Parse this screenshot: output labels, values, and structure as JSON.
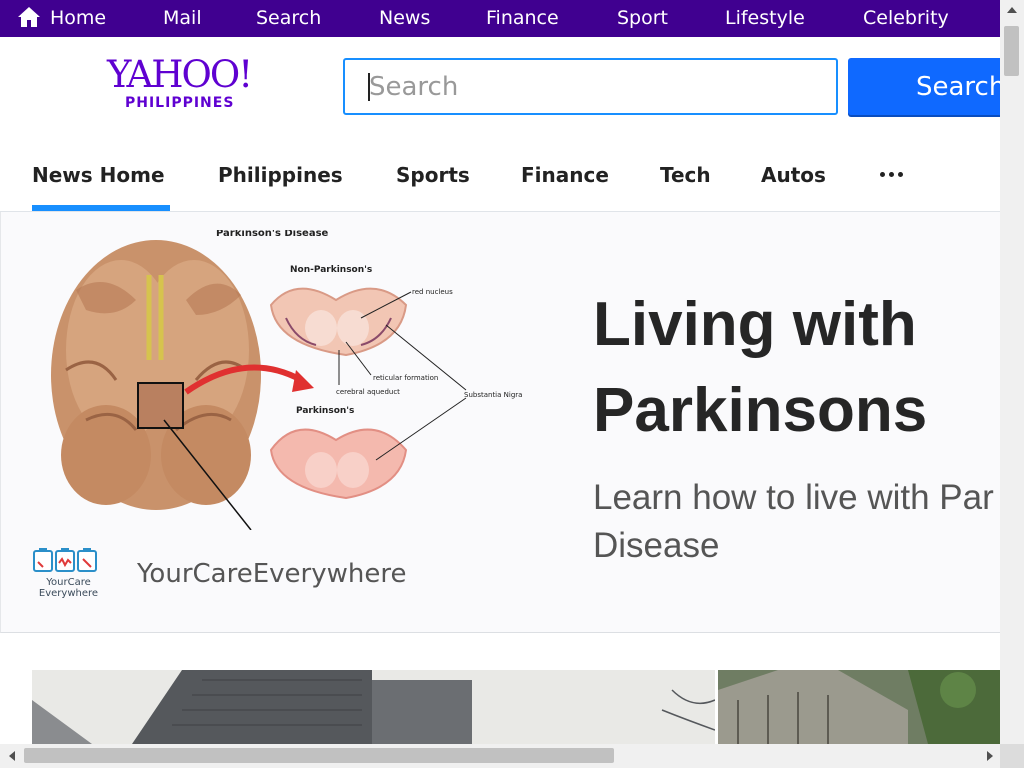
{
  "topbar": {
    "items": [
      "Home",
      "Mail",
      "Search",
      "News",
      "Finance",
      "Sport",
      "Lifestyle",
      "Celebrity"
    ],
    "home_icon": "home-icon",
    "background": "#400090"
  },
  "header": {
    "logo_word": "YAHOO!",
    "logo_region": "PHILIPPINES",
    "search_placeholder": "Search",
    "search_button": "Search",
    "brand_color": "#5f01d1",
    "accent": "#0f69ff"
  },
  "section_nav": {
    "tabs": [
      "News Home",
      "Philippines",
      "Sports",
      "Finance",
      "Tech",
      "Autos"
    ],
    "active_tab": "News Home",
    "more_icon": "more-dots-icon"
  },
  "ad": {
    "headline_line1": "Living with",
    "headline_line2": "Parkinsons",
    "sub_line1": "Learn how to live with Par",
    "sub_line2": "Disease",
    "brand": "YourCareEverywhere",
    "logo_caption_line1": "YourCare",
    "logo_caption_line2": "Everywhere",
    "illustration": {
      "title": "Parkinson's Disease",
      "label_non": "Non-Parkinson's",
      "label_park": "Parkinson's",
      "red_nucleus": "red nucleus",
      "reticular": "reticular formation",
      "aqueduct": "cerebral aqueduct",
      "nigra": "Substantia Nigra"
    }
  }
}
